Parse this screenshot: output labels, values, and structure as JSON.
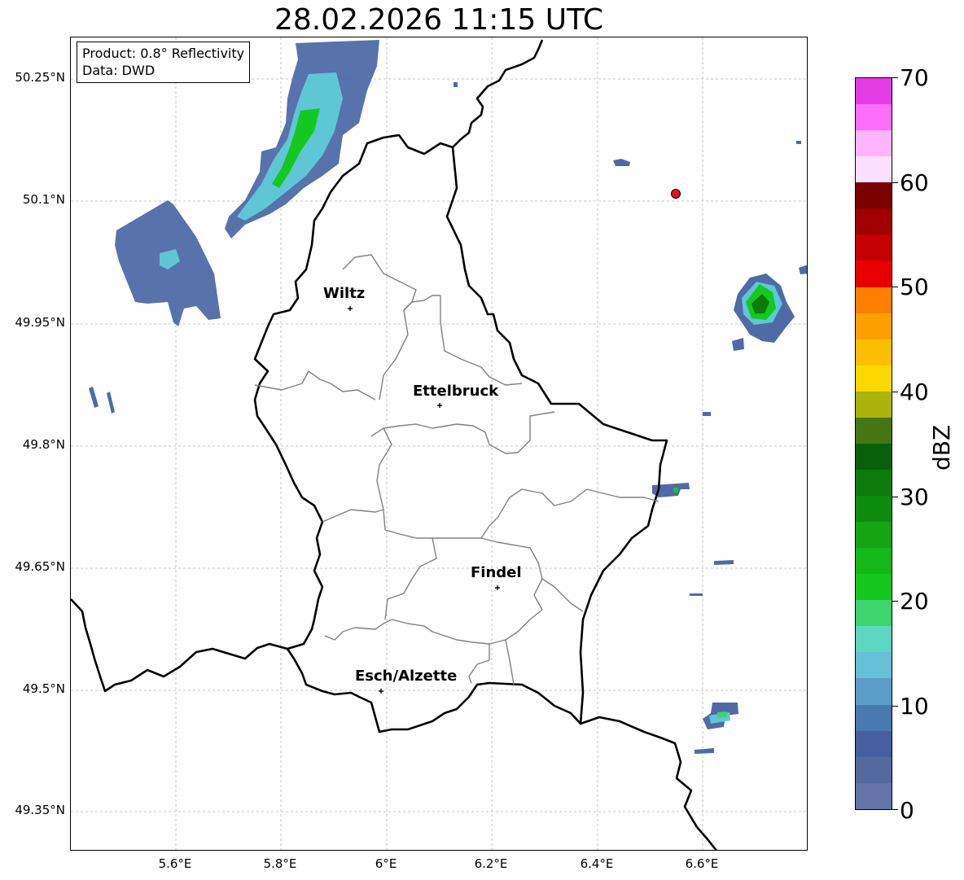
{
  "title": "28.02.2026 11:15 UTC",
  "info": {
    "product": "Product: 0.8° Reflectivity",
    "source": "Data: DWD"
  },
  "axes": {
    "lat_labels": [
      "50.25°N",
      "50.1°N",
      "49.95°N",
      "49.8°N",
      "49.65°N",
      "49.5°N",
      "49.35°N"
    ],
    "lon_labels": [
      "5.6°E",
      "5.8°E",
      "6°E",
      "6.2°E",
      "6.4°E",
      "6.6°E"
    ],
    "gridlines": true
  },
  "cities": [
    {
      "name": "Wiltz",
      "lon": 5.93,
      "lat": 49.97
    },
    {
      "name": "Ettelbruck",
      "lon": 6.1,
      "lat": 49.85
    },
    {
      "name": "Findel",
      "lon": 6.21,
      "lat": 49.63
    },
    {
      "name": "Esch/Alzette",
      "lon": 5.99,
      "lat": 49.5
    }
  ],
  "marker": {
    "name": "red-dot",
    "lon": 6.55,
    "lat": 50.11,
    "color": "#e8141a"
  },
  "colorbar": {
    "label": "dBZ",
    "ticks": [
      "70",
      "60",
      "50",
      "40",
      "30",
      "20",
      "10",
      "0"
    ],
    "min": 0,
    "max": 70,
    "colors": [
      "#6473a8",
      "#56699f",
      "#465f9e",
      "#4879b0",
      "#5c9dc8",
      "#66c1d8",
      "#5ed6c2",
      "#3ed46e",
      "#14c81e",
      "#14b81a",
      "#14a414",
      "#0e8c0e",
      "#0c7a0c",
      "#0a600a",
      "#457612",
      "#aab40a",
      "#fcd800",
      "#fcbe00",
      "#fca000",
      "#fc8000",
      "#e80000",
      "#c40000",
      "#a00000",
      "#7a0000",
      "#fde0fd",
      "#fdb4fd",
      "#fb6dfb",
      "#e43ce4"
    ]
  }
}
